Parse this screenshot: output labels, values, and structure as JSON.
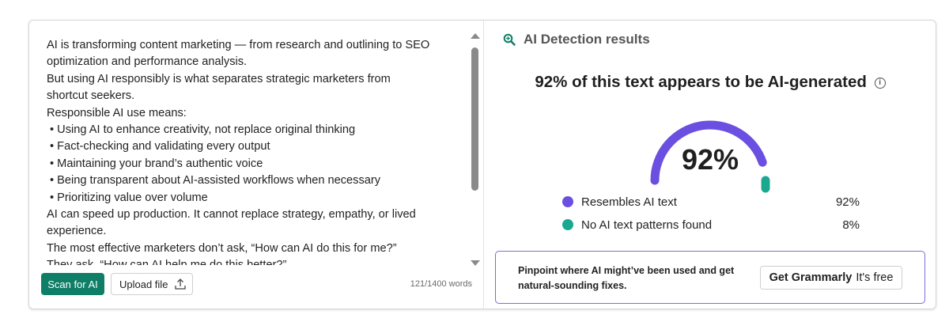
{
  "editor": {
    "lines": [
      {
        "text": "AI is transforming content marketing — from research and outlining to SEO",
        "bullet": false
      },
      {
        "text": "optimization and performance analysis.",
        "bullet": false
      },
      {
        "text": "But using AI responsibly is what separates strategic marketers from",
        "bullet": false
      },
      {
        "text": "shortcut seekers.",
        "bullet": false
      },
      {
        "text": "Responsible AI use means:",
        "bullet": false
      },
      {
        "text": "Using AI to enhance creativity, not replace original thinking",
        "bullet": true
      },
      {
        "text": "Fact-checking and validating every output",
        "bullet": true
      },
      {
        "text": "Maintaining your brand’s authentic voice",
        "bullet": true
      },
      {
        "text": "Being transparent about AI-assisted workflows when necessary",
        "bullet": true
      },
      {
        "text": "Prioritizing value over volume",
        "bullet": true
      },
      {
        "text": "AI can speed up production. It cannot replace strategy, empathy, or lived",
        "bullet": false
      },
      {
        "text": "experience.",
        "bullet": false
      },
      {
        "text": "The most effective marketers don’t ask, “How can AI do this for me?”",
        "bullet": false
      },
      {
        "text": " They ask, “How can AI help me do this better?”",
        "bullet": false
      }
    ],
    "word_count": "121/1400 words"
  },
  "buttons": {
    "scan_label": "Scan for AI",
    "upload_label": "Upload file"
  },
  "results": {
    "title": "AI Detection results",
    "headline": "92% of this text appears to be AI-generated",
    "info_glyph": "i",
    "gauge_percent_label": "92%",
    "gauge_fraction": 0.92,
    "legend": [
      {
        "label": "Resembles AI text",
        "value": "92%",
        "color": "#6b4fe0"
      },
      {
        "label": "No AI text patterns found",
        "value": "8%",
        "color": "#1aa891"
      }
    ]
  },
  "promo": {
    "text": "Pinpoint where AI might’ve been used and get natural-sounding fixes.",
    "cta_strong": "Get Grammarly",
    "cta_rest": "It's free"
  },
  "colors": {
    "accent_green": "#0e7e66",
    "ai_purple": "#6b4fe0",
    "human_teal": "#1aa891",
    "promo_border": "#7b6fd6"
  },
  "icons": {
    "detect": "magnifier-sparkle-icon",
    "upload": "upload-icon",
    "info": "info-icon"
  }
}
